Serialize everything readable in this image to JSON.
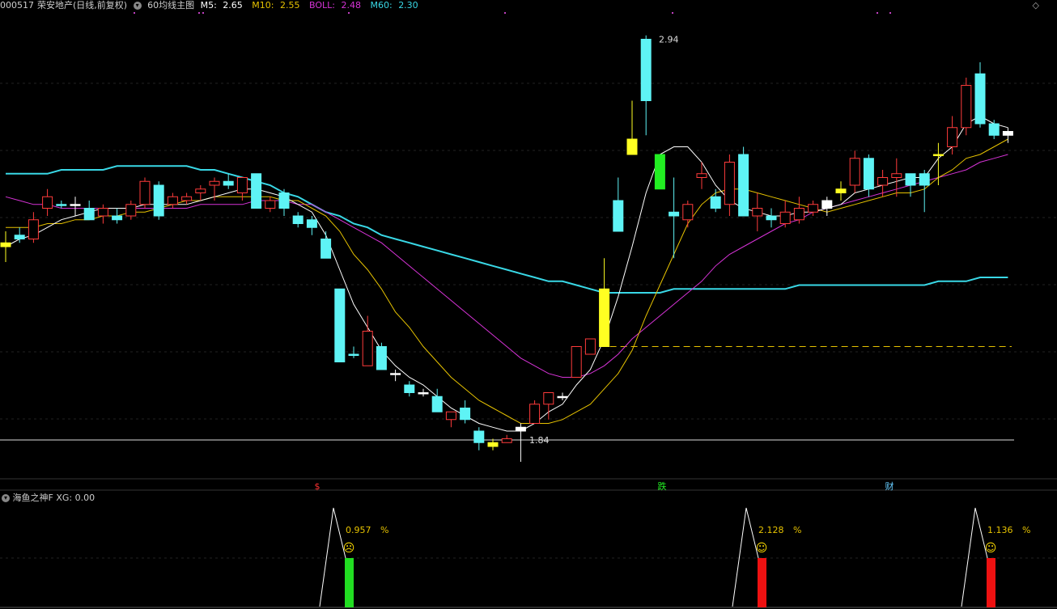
{
  "header": {
    "code": "000517",
    "name": "荣安地产(日线,前复权)",
    "indicator": "60均线主图",
    "m5_label": "M5:",
    "m5_value": "2.65",
    "m10_label": "M10:",
    "m10_value": "2.55",
    "boll_label": "BOLL:",
    "boll_value": "2.48",
    "m60_label": "M60:",
    "m60_value": "2.30",
    "colors": {
      "m5": "#ffffff",
      "m10": "#e6c200",
      "boll": "#d633d6",
      "m60": "#39d8e6"
    }
  },
  "top_right_icons": [
    "diamond-icon",
    "diamond-icon"
  ],
  "sub_header": {
    "name": "海鱼之神F",
    "xg_label": "XG:",
    "xg_value": "0.00"
  },
  "annotations": {
    "high": "2.94",
    "low": "1.84",
    "markers": [
      "$",
      "跌",
      "财"
    ]
  },
  "signals": [
    {
      "pct": "0.957",
      "unit": "%",
      "face": "☹",
      "bar_color": "#22dd22"
    },
    {
      "pct": "2.128",
      "unit": "%",
      "face": "☺",
      "bar_color": "#ee1111"
    },
    {
      "pct": "1.136",
      "unit": "%",
      "face": "☺",
      "bar_color": "#ee1111"
    }
  ],
  "chart_data": {
    "type": "candlestick",
    "ylim": [
      1.8,
      3.0
    ],
    "support_level": 2.14,
    "candles": [
      [
        2.4,
        2.44,
        2.36,
        2.41,
        "y"
      ],
      [
        2.43,
        2.45,
        2.41,
        2.42,
        "c"
      ],
      [
        2.42,
        2.49,
        2.41,
        2.47,
        "r"
      ],
      [
        2.53,
        2.55,
        2.48,
        2.5,
        "r"
      ],
      [
        2.51,
        2.52,
        2.5,
        2.51,
        "c"
      ],
      [
        2.51,
        2.53,
        2.48,
        2.51,
        "w"
      ],
      [
        2.5,
        2.52,
        2.47,
        2.47,
        "c"
      ],
      [
        2.48,
        2.51,
        2.46,
        2.5,
        "r"
      ],
      [
        2.48,
        2.5,
        2.46,
        2.47,
        "c"
      ],
      [
        2.48,
        2.52,
        2.47,
        2.51,
        "r"
      ],
      [
        2.51,
        2.58,
        2.5,
        2.57,
        "r"
      ],
      [
        2.56,
        2.57,
        2.47,
        2.48,
        "c"
      ],
      [
        2.51,
        2.54,
        2.5,
        2.53,
        "r"
      ],
      [
        2.52,
        2.54,
        2.51,
        2.53,
        "r"
      ],
      [
        2.54,
        2.56,
        2.52,
        2.55,
        "r"
      ],
      [
        2.57,
        2.58,
        2.52,
        2.56,
        "r"
      ],
      [
        2.57,
        2.59,
        2.55,
        2.56,
        "c"
      ],
      [
        2.54,
        2.58,
        2.52,
        2.58,
        "r"
      ],
      [
        2.59,
        2.59,
        2.52,
        2.5,
        "c"
      ],
      [
        2.5,
        2.53,
        2.49,
        2.52,
        "r"
      ],
      [
        2.54,
        2.55,
        2.48,
        2.5,
        "c"
      ],
      [
        2.48,
        2.49,
        2.45,
        2.46,
        "c"
      ],
      [
        2.47,
        2.48,
        2.43,
        2.45,
        "c"
      ],
      [
        2.42,
        2.44,
        2.37,
        2.37,
        "c"
      ],
      [
        2.29,
        2.29,
        2.12,
        2.1,
        "c"
      ],
      [
        2.12,
        2.14,
        2.11,
        2.12,
        "c"
      ],
      [
        2.09,
        2.22,
        2.09,
        2.18,
        "r"
      ],
      [
        2.14,
        2.15,
        2.09,
        2.08,
        "c"
      ],
      [
        2.07,
        2.08,
        2.05,
        2.07,
        "w"
      ],
      [
        2.04,
        2.05,
        2.01,
        2.02,
        "c"
      ],
      [
        2.02,
        2.03,
        2.01,
        2.02,
        "w"
      ],
      [
        2.01,
        2.03,
        1.98,
        1.97,
        "c"
      ],
      [
        1.95,
        1.97,
        1.93,
        1.97,
        "r"
      ],
      [
        1.98,
        2.0,
        1.94,
        1.95,
        "c"
      ],
      [
        1.92,
        1.93,
        1.87,
        1.89,
        "c"
      ],
      [
        1.89,
        1.9,
        1.87,
        1.88,
        "y"
      ],
      [
        1.9,
        1.91,
        1.89,
        1.89,
        "r"
      ],
      [
        1.92,
        1.94,
        1.84,
        1.93,
        "w"
      ],
      [
        1.94,
        2.0,
        1.94,
        1.99,
        "r"
      ],
      [
        1.99,
        2.01,
        1.95,
        2.02,
        "r"
      ],
      [
        2.01,
        2.02,
        2.0,
        2.01,
        "w"
      ],
      [
        2.06,
        2.1,
        2.06,
        2.14,
        "r"
      ],
      [
        2.12,
        2.16,
        2.12,
        2.16,
        "r"
      ],
      [
        2.29,
        2.37,
        2.14,
        2.14,
        "y"
      ],
      [
        2.44,
        2.58,
        2.47,
        2.52,
        "c"
      ],
      [
        2.68,
        2.78,
        2.66,
        2.64,
        "y"
      ],
      [
        2.94,
        2.95,
        2.69,
        2.78,
        "c"
      ],
      [
        2.64,
        2.64,
        2.55,
        2.55,
        "g"
      ],
      [
        2.49,
        2.58,
        2.37,
        2.48,
        "c"
      ],
      [
        2.47,
        2.52,
        2.45,
        2.51,
        "r"
      ],
      [
        2.58,
        2.62,
        2.55,
        2.59,
        "r"
      ],
      [
        2.53,
        2.55,
        2.49,
        2.5,
        "c"
      ],
      [
        2.62,
        2.64,
        2.48,
        2.51,
        "r"
      ],
      [
        2.64,
        2.66,
        2.49,
        2.48,
        "c"
      ],
      [
        2.5,
        2.54,
        2.44,
        2.48,
        "r"
      ],
      [
        2.48,
        2.5,
        2.45,
        2.47,
        "c"
      ],
      [
        2.46,
        2.52,
        2.45,
        2.49,
        "r"
      ],
      [
        2.47,
        2.53,
        2.46,
        2.5,
        "r"
      ],
      [
        2.49,
        2.52,
        2.48,
        2.51,
        "r"
      ],
      [
        2.5,
        2.53,
        2.48,
        2.52,
        "w"
      ],
      [
        2.54,
        2.57,
        2.52,
        2.55,
        "y"
      ],
      [
        2.56,
        2.65,
        2.54,
        2.63,
        "r"
      ],
      [
        2.63,
        2.64,
        2.53,
        2.55,
        "c"
      ],
      [
        2.56,
        2.6,
        2.53,
        2.58,
        "r"
      ],
      [
        2.59,
        2.63,
        2.53,
        2.58,
        "r"
      ],
      [
        2.59,
        2.59,
        2.53,
        2.56,
        "c"
      ],
      [
        2.56,
        2.6,
        2.49,
        2.59,
        "c"
      ],
      [
        2.64,
        2.67,
        2.56,
        2.64,
        "y"
      ],
      [
        2.66,
        2.74,
        2.64,
        2.71,
        "r"
      ],
      [
        2.71,
        2.84,
        2.69,
        2.82,
        "r"
      ],
      [
        2.85,
        2.88,
        2.71,
        2.72,
        "c"
      ],
      [
        2.72,
        2.73,
        2.68,
        2.69,
        "c"
      ],
      [
        2.69,
        2.71,
        2.67,
        2.7,
        "w"
      ]
    ],
    "m5": [
      2.4,
      2.42,
      2.43,
      2.45,
      2.47,
      2.48,
      2.49,
      2.5,
      2.5,
      2.5,
      2.51,
      2.51,
      2.51,
      2.51,
      2.52,
      2.53,
      2.54,
      2.55,
      2.55,
      2.54,
      2.53,
      2.51,
      2.49,
      2.43,
      2.34,
      2.25,
      2.19,
      2.13,
      2.09,
      2.06,
      2.04,
      2.01,
      1.98,
      1.96,
      1.94,
      1.93,
      1.92,
      1.92,
      1.94,
      1.97,
      1.99,
      2.04,
      2.08,
      2.16,
      2.27,
      2.4,
      2.54,
      2.64,
      2.66,
      2.66,
      2.62,
      2.56,
      2.52,
      2.5,
      2.49,
      2.48,
      2.48,
      2.49,
      2.49,
      2.5,
      2.51,
      2.54,
      2.55,
      2.56,
      2.57,
      2.58,
      2.58,
      2.63,
      2.66,
      2.72,
      2.74,
      2.72,
      2.71
    ],
    "m10": [
      2.45,
      2.45,
      2.45,
      2.46,
      2.46,
      2.47,
      2.47,
      2.48,
      2.48,
      2.49,
      2.49,
      2.5,
      2.51,
      2.52,
      2.52,
      2.53,
      2.53,
      2.53,
      2.53,
      2.53,
      2.52,
      2.52,
      2.5,
      2.48,
      2.44,
      2.38,
      2.34,
      2.29,
      2.23,
      2.19,
      2.14,
      2.1,
      2.06,
      2.03,
      2.0,
      1.98,
      1.96,
      1.94,
      1.94,
      1.94,
      1.95,
      1.97,
      1.99,
      2.03,
      2.07,
      2.13,
      2.22,
      2.3,
      2.38,
      2.46,
      2.51,
      2.54,
      2.55,
      2.55,
      2.54,
      2.53,
      2.52,
      2.51,
      2.5,
      2.49,
      2.5,
      2.51,
      2.52,
      2.53,
      2.54,
      2.54,
      2.55,
      2.58,
      2.6,
      2.63,
      2.64,
      2.66,
      2.68
    ],
    "boll": [
      2.53,
      2.52,
      2.51,
      2.51,
      2.5,
      2.5,
      2.5,
      2.5,
      2.5,
      2.5,
      2.5,
      2.5,
      2.5,
      2.5,
      2.51,
      2.51,
      2.51,
      2.51,
      2.52,
      2.52,
      2.52,
      2.51,
      2.51,
      2.49,
      2.47,
      2.45,
      2.43,
      2.41,
      2.38,
      2.35,
      2.32,
      2.29,
      2.26,
      2.23,
      2.2,
      2.17,
      2.14,
      2.11,
      2.09,
      2.07,
      2.06,
      2.06,
      2.07,
      2.09,
      2.12,
      2.16,
      2.19,
      2.22,
      2.25,
      2.28,
      2.31,
      2.35,
      2.38,
      2.4,
      2.42,
      2.44,
      2.46,
      2.47,
      2.49,
      2.5,
      2.51,
      2.52,
      2.53,
      2.54,
      2.55,
      2.56,
      2.57,
      2.58,
      2.59,
      2.6,
      2.62,
      2.63,
      2.64
    ],
    "m60": [
      2.59,
      2.59,
      2.59,
      2.59,
      2.6,
      2.6,
      2.6,
      2.6,
      2.61,
      2.61,
      2.61,
      2.61,
      2.61,
      2.61,
      2.6,
      2.6,
      2.59,
      2.58,
      2.57,
      2.56,
      2.54,
      2.53,
      2.51,
      2.49,
      2.48,
      2.46,
      2.45,
      2.43,
      2.42,
      2.41,
      2.4,
      2.39,
      2.38,
      2.37,
      2.36,
      2.35,
      2.34,
      2.33,
      2.32,
      2.31,
      2.31,
      2.3,
      2.29,
      2.28,
      2.28,
      2.28,
      2.28,
      2.28,
      2.29,
      2.29,
      2.29,
      2.29,
      2.29,
      2.29,
      2.29,
      2.29,
      2.29,
      2.3,
      2.3,
      2.3,
      2.3,
      2.3,
      2.3,
      2.3,
      2.3,
      2.3,
      2.3,
      2.31,
      2.31,
      2.31,
      2.32,
      2.32,
      2.32
    ],
    "signal_candle_index": [
      23,
      47,
      66
    ]
  }
}
